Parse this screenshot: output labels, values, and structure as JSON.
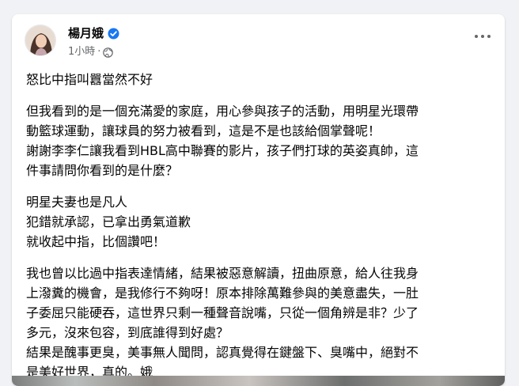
{
  "post": {
    "author_name": "楊月娥",
    "verified_icon": "verified-badge-icon",
    "timestamp": "1小時",
    "separator": "·",
    "privacy_icon": "globe-icon",
    "more_icon": "more-options-icon",
    "paragraphs": [
      {
        "lines": [
          "怒比中指叫囂當然不好"
        ]
      },
      {
        "lines": [
          "但我看到的是一個充滿愛的家庭，用心參與孩子的活動，用明星光環帶",
          "動籃球運動，讓球員的努力被看到，這是不是也該給個掌聲呢！",
          "謝謝李李仁讓我看到HBL高中聯賽的影片，孩子們打球的英姿真帥，這",
          "件事請問你看到的是什麼？"
        ]
      },
      {
        "lines": [
          "明星夫妻也是凡人",
          "犯錯就承認，已拿出勇氣道歉",
          "就收起中指，比個讚吧！"
        ]
      },
      {
        "lines": [
          "我也曾以比過中指表達情緒，結果被惡意解讀，扭曲原意，給人往我身",
          "上潑糞的機會，是我修行不夠呀！原本排除萬難參與的美意盡失，一肚",
          "子委屈只能硬吞，這世界只剩一種聲音說嘴，只從一個角辨是非？少了",
          "多元，沒來包容，到底誰得到好處？",
          "結果是醜事更臭，美事無人聞問，認真覺得在鍵盤下、臭嘴中，絕對不",
          "是美好世界，真的。娥"
        ]
      }
    ]
  }
}
